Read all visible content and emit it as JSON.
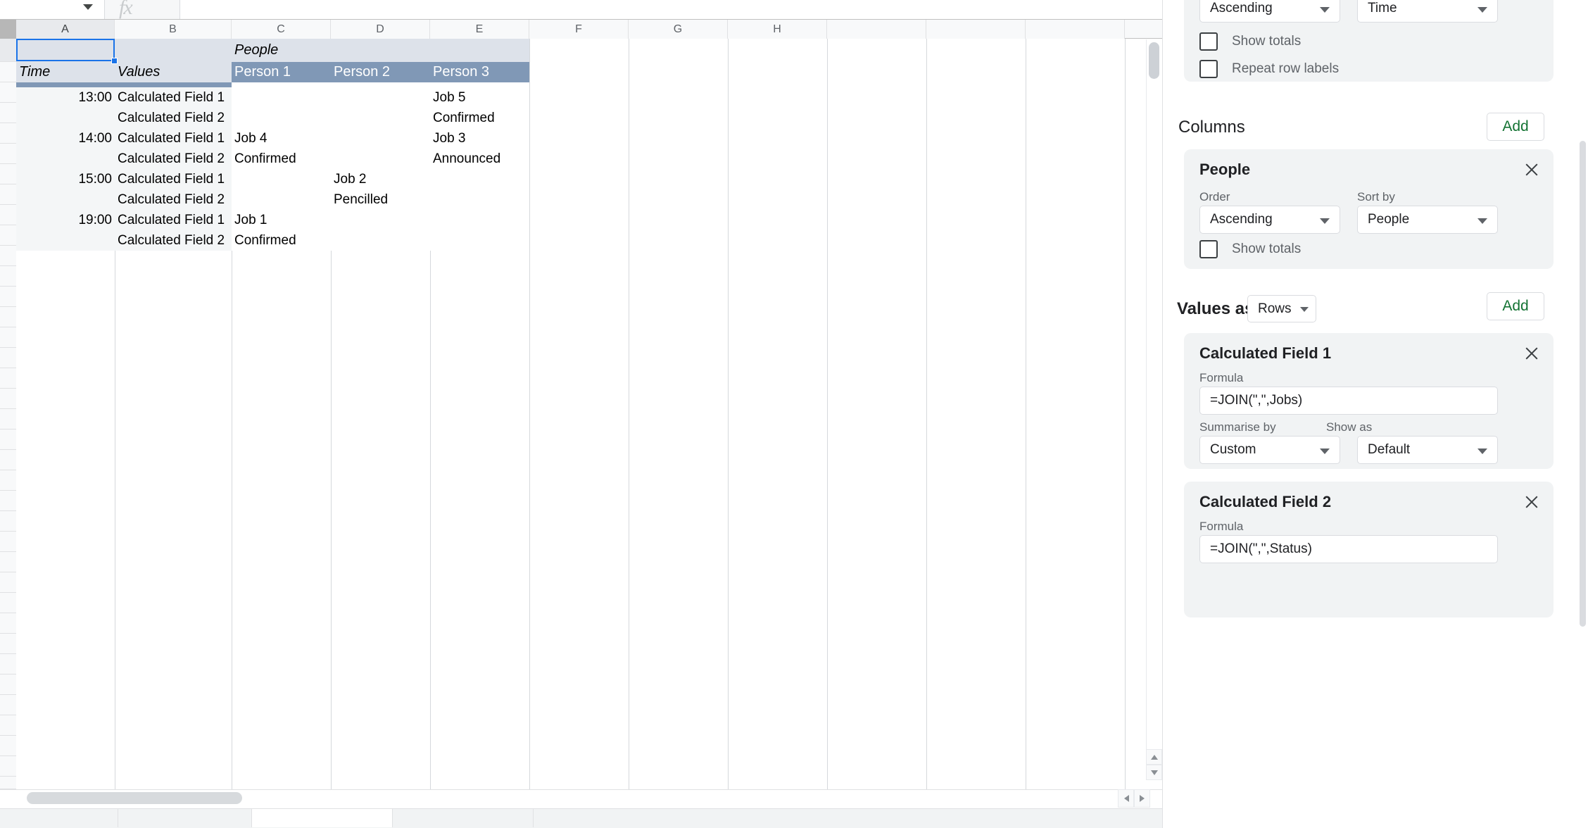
{
  "spreadsheet": {
    "column_headers": [
      "A",
      "B",
      "C",
      "D",
      "E",
      "F",
      "G",
      "H"
    ],
    "selected_column": "A",
    "selected_cell": "A1",
    "formula_bar": {
      "fx_icon": "fx-icon",
      "value": ""
    },
    "pivot_table": {
      "column_group_label": "People",
      "row_header_labels": [
        "Time",
        "Values"
      ],
      "column_headers": [
        "Person 1",
        "Person 2",
        "Person 3"
      ],
      "rows": [
        {
          "time": "13:00",
          "value_field": "Calculated Field 1",
          "person1": "",
          "person2": "",
          "person3": "Job 5"
        },
        {
          "time": "",
          "value_field": "Calculated Field 2",
          "person1": "",
          "person2": "",
          "person3": "Confirmed"
        },
        {
          "time": "14:00",
          "value_field": "Calculated Field 1",
          "person1": "Job 4",
          "person2": "",
          "person3": "Job 3"
        },
        {
          "time": "",
          "value_field": "Calculated Field 2",
          "person1": "Confirmed",
          "person2": "",
          "person3": "Announced"
        },
        {
          "time": "15:00",
          "value_field": "Calculated Field 1",
          "person1": "",
          "person2": "Job 2",
          "person3": ""
        },
        {
          "time": "",
          "value_field": "Calculated Field 2",
          "person1": "",
          "person2": "Pencilled",
          "person3": ""
        },
        {
          "time": "19:00",
          "value_field": "Calculated Field 1",
          "person1": "Job 1",
          "person2": "",
          "person3": ""
        },
        {
          "time": "",
          "value_field": "Calculated Field 2",
          "person1": "Confirmed",
          "person2": "",
          "person3": ""
        }
      ]
    },
    "scrollbars": {
      "vertical_up_icon": "scroll-up-arrow-icon",
      "vertical_down_icon": "scroll-down-arrow-icon",
      "horizontal_left_icon": "scroll-left-arrow-icon",
      "horizontal_right_icon": "scroll-right-arrow-icon"
    }
  },
  "panel": {
    "rows_card_partial": {
      "order_value": "Ascending",
      "sort_by_value": "Time",
      "show_totals_label": "Show totals",
      "repeat_row_labels_label": "Repeat row labels",
      "show_totals_checked": false,
      "repeat_row_labels_checked": false
    },
    "columns_section": {
      "title": "Columns",
      "add_label": "Add",
      "card": {
        "title": "People",
        "close_icon": "close-icon",
        "order_label": "Order",
        "order_value": "Ascending",
        "sort_by_label": "Sort by",
        "sort_by_value": "People",
        "show_totals_label": "Show totals",
        "show_totals_checked": false
      }
    },
    "values_section": {
      "values_as_label": "Values as:",
      "values_as_value": "Rows",
      "add_label": "Add",
      "fields": [
        {
          "title": "Calculated Field 1",
          "close_icon": "close-icon",
          "formula_label": "Formula",
          "formula_value": "=JOIN(\",\",Jobs)",
          "summarise_by_label": "Summarise by",
          "summarise_by_value": "Custom",
          "show_as_label": "Show as",
          "show_as_value": "Default"
        },
        {
          "title": "Calculated Field 2",
          "close_icon": "close-icon",
          "formula_label": "Formula",
          "formula_value": "=JOIN(\",\",Status)"
        }
      ]
    },
    "colors": {
      "accent_green": "#137333",
      "card_bg": "#f1f3f4",
      "pivot_header_blue": "#8098b6",
      "pivot_header_light": "#dde2ea",
      "selection_blue": "#1a73e8"
    }
  }
}
